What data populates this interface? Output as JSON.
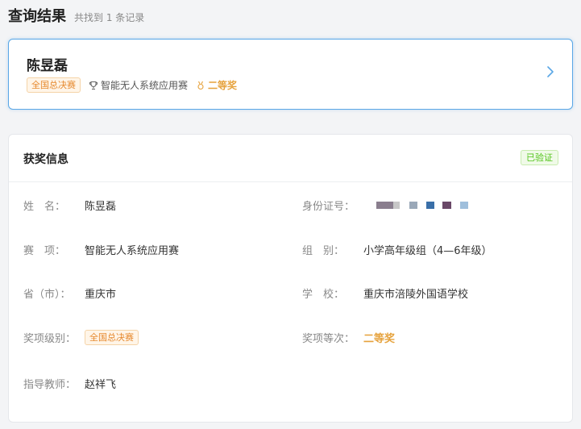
{
  "header": {
    "title": "查询结果",
    "count_text": "共找到 1 条记录"
  },
  "result": {
    "name": "陈昱磊",
    "level_badge": "全国总决赛",
    "event": "智能无人系统应用赛",
    "prize": "二等奖",
    "icons": {
      "event": "trophy-icon",
      "prize": "medal-icon",
      "open": "chevron-right-icon"
    }
  },
  "info": {
    "title": "获奖信息",
    "verified": "已验证",
    "fields": {
      "name_label": "姓　名：",
      "name": "陈昱磊",
      "id_label": "身份证号：",
      "event_label": "赛　项：",
      "event": "智能无人系统应用赛",
      "group_label": "组　别：",
      "group": "小学高年级组（4—6年级）",
      "province_label": "省（市）：",
      "province": "重庆市",
      "school_label": "学　校：",
      "school": "重庆市涪陵外国语学校",
      "level_label": "奖项级别：",
      "level": "全国总决赛",
      "rank_label": "奖项等次：",
      "rank": "二等奖",
      "teacher_label": "指导教师：",
      "teacher": "赵祥飞"
    }
  },
  "colors": {
    "accent": "#5aa7e6",
    "gold": "#e6a23c",
    "badge_orange": "#e6892e",
    "green": "#52c41a"
  }
}
